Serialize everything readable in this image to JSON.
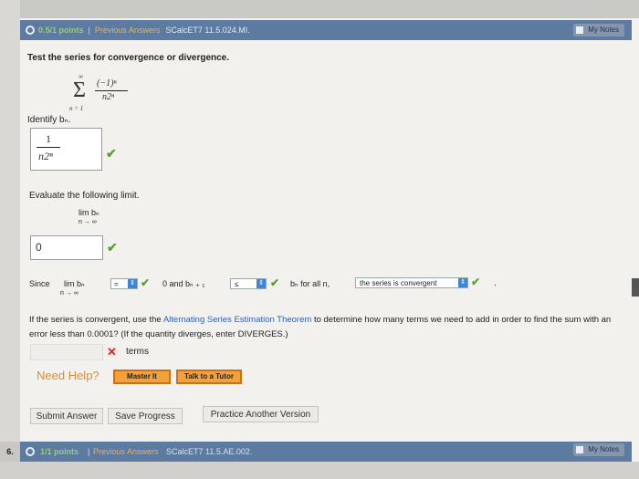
{
  "q5": {
    "points": "0.5/1 points",
    "previous_answers": "Previous Answers",
    "code": "SCalcET7 11.5.024.MI.",
    "my_notes": "My Notes"
  },
  "prompt": "Test the series for convergence or divergence.",
  "series": {
    "upper": "∞",
    "lower": "n = 1",
    "numerator": "(−1)ⁿ",
    "denominator": "n2ⁿ"
  },
  "identify": {
    "label": "Identify bₙ.",
    "numerator": "1",
    "denominator": "n2ⁿ"
  },
  "limit": {
    "label": "Evaluate the following limit.",
    "expr": "lim bₙ",
    "sub": "n → ∞",
    "answer": "0"
  },
  "since": {
    "since": "Since",
    "lim": "lim bₙ",
    "sub": "n → ∞",
    "sel1": "=",
    "mid": "0 and bₙ ₊ ₁",
    "sel2": "≤",
    "bn_all": "bₙ for all n,",
    "sel3": "the series is convergent",
    "dot": "."
  },
  "estimation": {
    "before": "If the series is convergent, use the",
    "link": "Alternating Series Estimation Theorem",
    "after": "to determine how many terms we need to add in order to find the sum with an error less than 0.0001? (If the quantity diverges, enter DIVERGES.)",
    "terms": "terms"
  },
  "help": {
    "label": "Need Help?",
    "master": "Master It",
    "tutor": "Talk to a Tutor"
  },
  "actions": {
    "submit": "Submit Answer",
    "save": "Save Progress",
    "practice": "Practice Another Version"
  },
  "q6": {
    "number": "6.",
    "points": "1/1 points",
    "previous_answers": "Previous Answers",
    "code": "SCalcET7 11.5.AE.002.",
    "my_notes": "My Notes"
  },
  "colors": {
    "header": "#5d7aa0",
    "check": "#5ba233",
    "cross": "#dd2222",
    "link": "#2f5fb3",
    "help": "#e28a2f"
  }
}
